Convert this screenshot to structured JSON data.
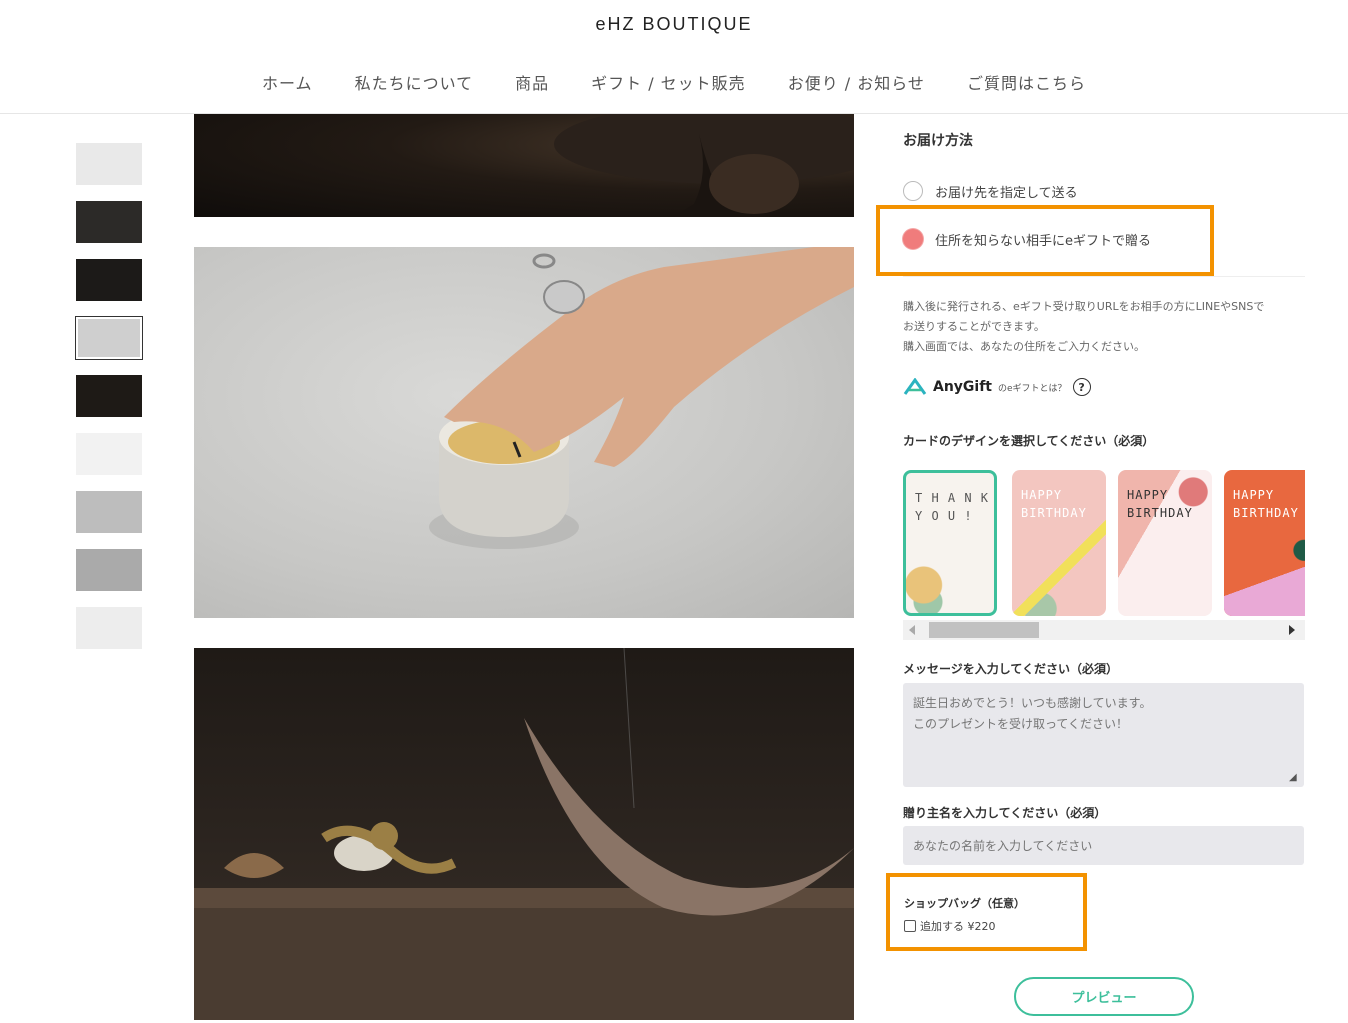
{
  "header": {
    "brand": "eHZ BOUTIQUE",
    "nav": [
      "ホーム",
      "私たちについて",
      "商品",
      "ギフト / セット販売",
      "お便り / お知らせ",
      "ご質問はこちら"
    ]
  },
  "gallery": {
    "thumbnail_count": 9,
    "selected_index": 3,
    "thumb_colors": [
      "#e9e9e9",
      "#2c2a28",
      "#1c1a18",
      "#cfcfcf",
      "#1e1a16",
      "#f2f2f2",
      "#bdbdbd",
      "#aaaaaa",
      "#ededed"
    ]
  },
  "delivery": {
    "title": "お届け方法",
    "option1": "お届け先を指定して送る",
    "option2": "住所を知らない相手にeギフトで贈る",
    "desc_line1": "購入後に発行される、eギフト受け取りURLをお相手の方にLINEやSNSで",
    "desc_line2": "お送りすることができます。",
    "desc_line3": "購入画面では、あなたの住所をご入力ください。"
  },
  "anygift": {
    "logo": "AnyGift",
    "what": "のeギフトとは？",
    "help": "?"
  },
  "cards": {
    "label": "カードのデザインを選択してください（必須）",
    "items": [
      {
        "text": "T H A N K\nY O U !",
        "bg": "#f7f3ee",
        "color": "#555"
      },
      {
        "text": "HAPPY\nBIRTHDAY",
        "bg": "#f3c6c0",
        "color": "#ffffff"
      },
      {
        "text": "HAPPY\nBIRTHDAY",
        "bg": "#fbeeee",
        "color": "#333333"
      },
      {
        "text": "HAPPY\nBIRTHDAY",
        "bg": "#e8683f",
        "color": "#ffffff"
      }
    ]
  },
  "message": {
    "label": "メッセージを入力してください（必須）",
    "placeholder": "誕生日おめでとう！いつも感謝しています。\nこのプレゼントを受け取ってください！"
  },
  "sender": {
    "label": "贈り主名を入力してください（必須）",
    "placeholder": "あなたの名前を入力してください"
  },
  "bag": {
    "title": "ショップバッグ（任意）",
    "option": "追加する ¥220"
  },
  "preview_button": "プレビュー",
  "colors": {
    "accent": "#3dbf9b",
    "highlight": "#f39200",
    "radio_checked": "#f07c7c"
  }
}
